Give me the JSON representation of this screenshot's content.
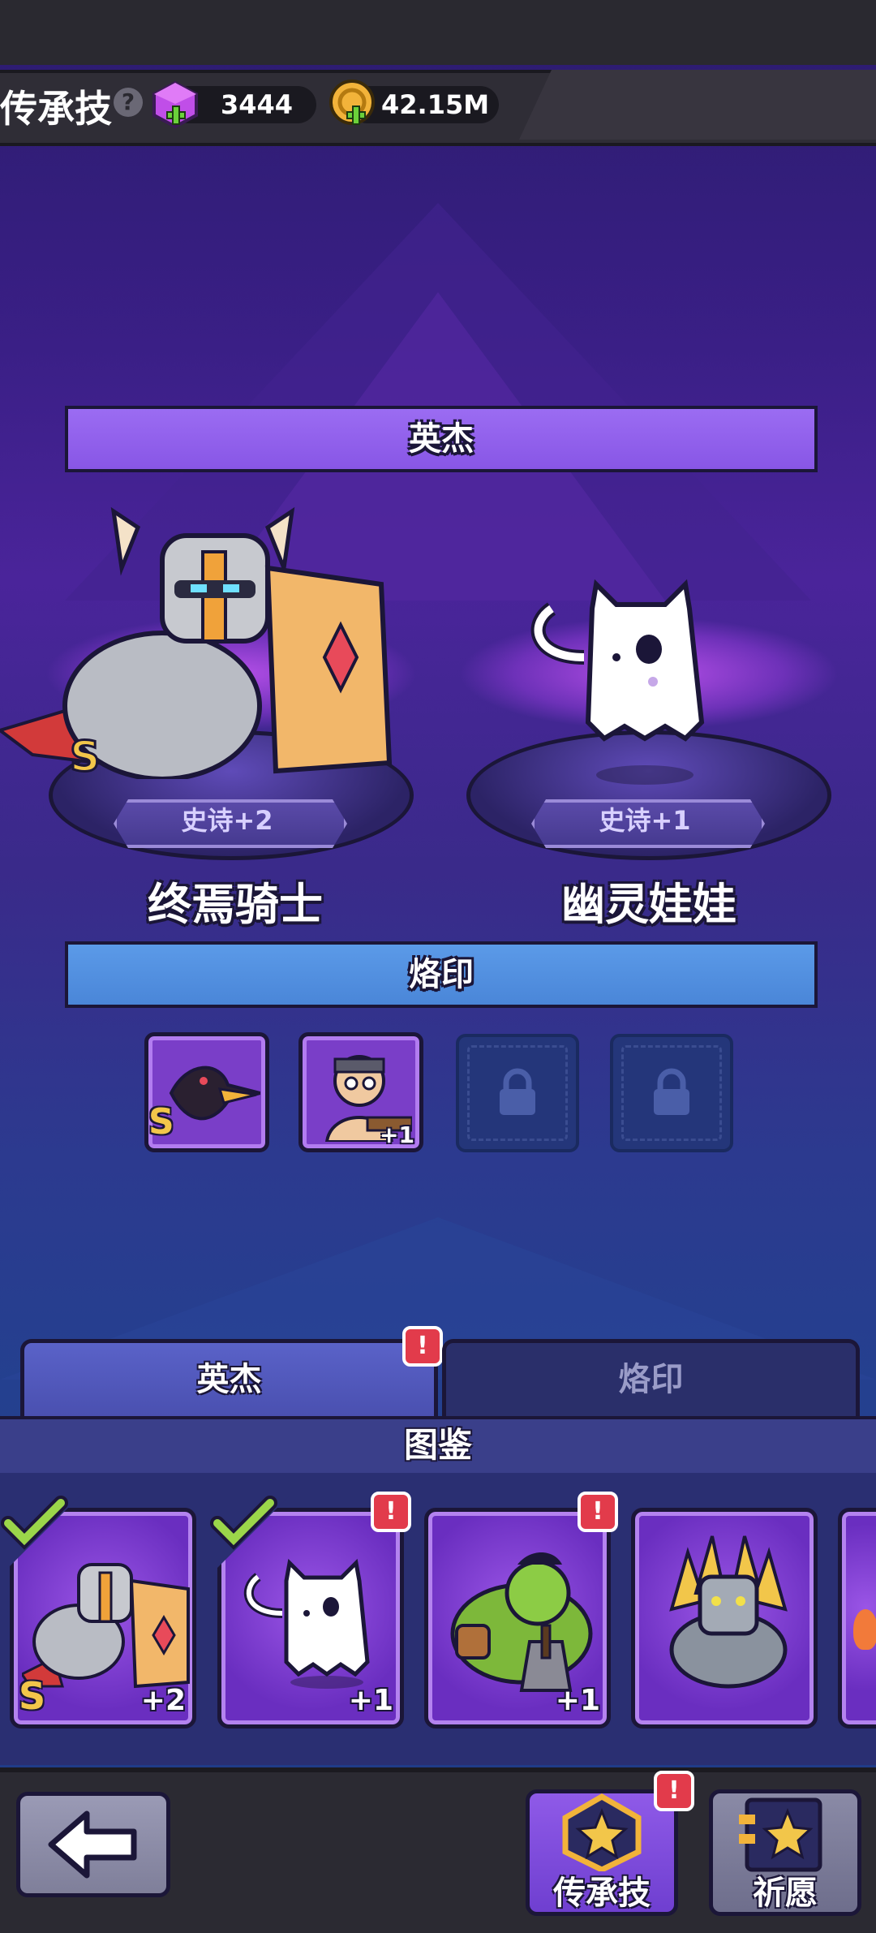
{
  "header": {
    "title": "传承技",
    "help_icon": "question-icon",
    "gems": "3444",
    "gold": "42.15M"
  },
  "top_banner": "英杰",
  "heroes": [
    {
      "name": "终焉骑士",
      "rarity": "史诗+2",
      "grade": "S"
    },
    {
      "name": "幽灵娃娃",
      "rarity": "史诗+1"
    }
  ],
  "seal_banner": "烙印",
  "seals": [
    {
      "state": "filled",
      "grade": "S"
    },
    {
      "state": "filled",
      "plus": "+1"
    },
    {
      "state": "locked"
    },
    {
      "state": "locked"
    }
  ],
  "tabs": [
    {
      "label": "英杰",
      "active": true,
      "alert": "!"
    },
    {
      "label": "烙印",
      "active": false
    }
  ],
  "codex_title": "图鉴",
  "codex_cards": [
    {
      "grade": "S",
      "plus": "+2",
      "checked": true
    },
    {
      "plus": "+1",
      "checked": true,
      "alert": "!"
    },
    {
      "plus": "+1",
      "alert": "!"
    },
    {}
  ],
  "bottom_nav": {
    "skill_label": "传承技",
    "skill_alert": "!",
    "wish_label": "祈愿"
  },
  "colors": {
    "banner_purple": "#8856e6",
    "banner_blue": "#4a86d8",
    "alert_red": "#e23b4b",
    "gold": "#f2b33a"
  }
}
